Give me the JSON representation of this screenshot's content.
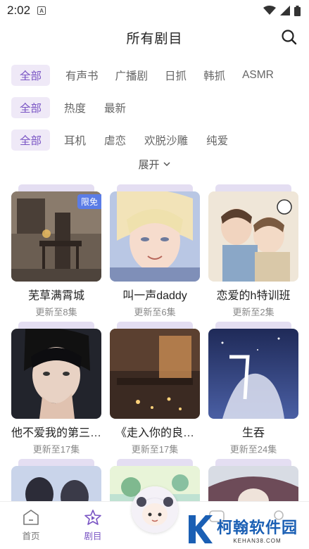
{
  "status": {
    "time": "2:02"
  },
  "header": {
    "title": "所有剧目"
  },
  "filters": {
    "type": [
      "全部",
      "有声书",
      "广播剧",
      "日抓",
      "韩抓",
      "ASMR"
    ],
    "sort": [
      "全部",
      "热度",
      "最新"
    ],
    "tags": [
      "全部",
      "耳机",
      "虐恋",
      "欢脱沙雕",
      "纯爱"
    ],
    "expand_label": "展开"
  },
  "cards": [
    {
      "title": "芜草满霄城",
      "sub": "更新至8集",
      "badge": "限免"
    },
    {
      "title": "叫一声daddy",
      "sub": "更新至6集"
    },
    {
      "title": "恋爱的h特训班",
      "sub": "更新至2集"
    },
    {
      "title": "他不爱我的第三…",
      "sub": "更新至17集"
    },
    {
      "title": "《走入你的良…",
      "sub": "更新至17集"
    },
    {
      "title": "生吞",
      "sub": "更新至24集"
    }
  ],
  "tabbar": {
    "home": "首页",
    "drama": "剧目"
  },
  "watermark": {
    "cn": "柯翰软件园",
    "en": "KEHAN38.COM"
  },
  "colors": {
    "accent": "#7a55c4",
    "chip_bg": "#efe9f7",
    "badge": "#5b7ce6"
  }
}
